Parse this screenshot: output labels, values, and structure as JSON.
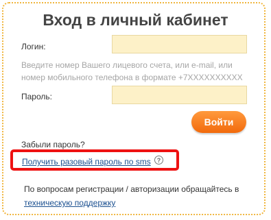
{
  "title": "Вход в личный кабинет",
  "login": {
    "label": "Логин:",
    "hint": "Введите номер Вашего лицевого счета, или e-mail, или номер мобильного телефона в формате +7XXXXXXXXXX",
    "value": ""
  },
  "password": {
    "label": "Пароль:",
    "value": ""
  },
  "submit_label": "Войти",
  "forgot_label": "Забыли пароль?",
  "sms_label": "Получить разовый пароль по sms",
  "help_glyph": "?",
  "support": {
    "text": "По вопросам регистрации / авторизации обращайтесь в",
    "link": "техническую поддержку"
  },
  "colors": {
    "border": "#f0b53c",
    "field_bg": "#fdf1c8",
    "button": "#f26a0c",
    "highlight": "#ee1111",
    "link": "#1a4f8f"
  }
}
